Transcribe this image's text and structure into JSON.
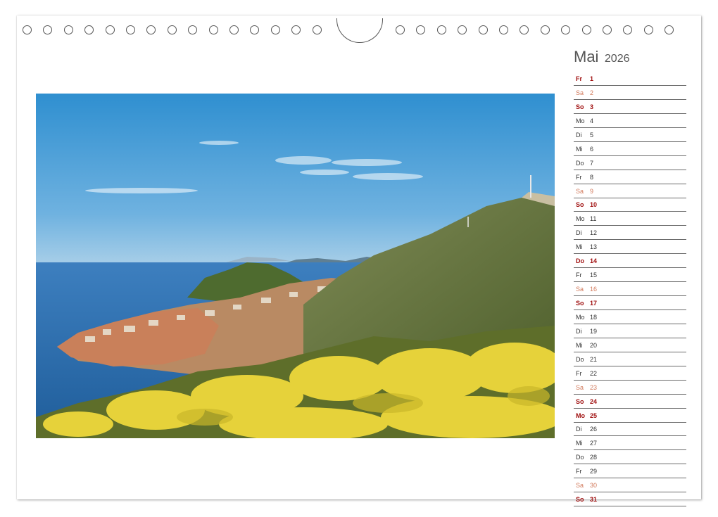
{
  "calendar": {
    "month": "Mai",
    "year": "2026",
    "days": [
      {
        "wd": "Fr",
        "d": "1",
        "type": "hol"
      },
      {
        "wd": "Sa",
        "d": "2",
        "type": "sat"
      },
      {
        "wd": "So",
        "d": "3",
        "type": "sun"
      },
      {
        "wd": "Mo",
        "d": "4",
        "type": "normal"
      },
      {
        "wd": "Di",
        "d": "5",
        "type": "normal"
      },
      {
        "wd": "Mi",
        "d": "6",
        "type": "normal"
      },
      {
        "wd": "Do",
        "d": "7",
        "type": "normal"
      },
      {
        "wd": "Fr",
        "d": "8",
        "type": "normal"
      },
      {
        "wd": "Sa",
        "d": "9",
        "type": "sat"
      },
      {
        "wd": "So",
        "d": "10",
        "type": "sun"
      },
      {
        "wd": "Mo",
        "d": "11",
        "type": "normal"
      },
      {
        "wd": "Di",
        "d": "12",
        "type": "normal"
      },
      {
        "wd": "Mi",
        "d": "13",
        "type": "normal"
      },
      {
        "wd": "Do",
        "d": "14",
        "type": "hol"
      },
      {
        "wd": "Fr",
        "d": "15",
        "type": "normal"
      },
      {
        "wd": "Sa",
        "d": "16",
        "type": "sat"
      },
      {
        "wd": "So",
        "d": "17",
        "type": "sun"
      },
      {
        "wd": "Mo",
        "d": "18",
        "type": "normal"
      },
      {
        "wd": "Di",
        "d": "19",
        "type": "normal"
      },
      {
        "wd": "Mi",
        "d": "20",
        "type": "normal"
      },
      {
        "wd": "Do",
        "d": "21",
        "type": "normal"
      },
      {
        "wd": "Fr",
        "d": "22",
        "type": "normal"
      },
      {
        "wd": "Sa",
        "d": "23",
        "type": "sat"
      },
      {
        "wd": "So",
        "d": "24",
        "type": "sun"
      },
      {
        "wd": "Mo",
        "d": "25",
        "type": "hol"
      },
      {
        "wd": "Di",
        "d": "26",
        "type": "normal"
      },
      {
        "wd": "Mi",
        "d": "27",
        "type": "normal"
      },
      {
        "wd": "Do",
        "d": "28",
        "type": "normal"
      },
      {
        "wd": "Fr",
        "d": "29",
        "type": "normal"
      },
      {
        "wd": "Sa",
        "d": "30",
        "type": "sat"
      },
      {
        "wd": "So",
        "d": "31",
        "type": "sun"
      }
    ]
  },
  "colors": {
    "sunday_holiday": "#a01010",
    "saturday": "#d27a5c",
    "weekday": "#333333"
  },
  "photo": {
    "subject": "coastal-town-with-mountain-and-yellow-flowers"
  }
}
